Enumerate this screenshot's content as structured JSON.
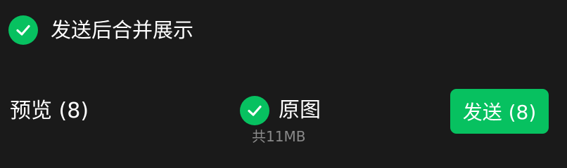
{
  "merge": {
    "checked": true,
    "icon": "check-circle-icon",
    "label": "发送后合并展示"
  },
  "bottom_bar": {
    "preview_label": "预览 (8)",
    "original": {
      "checked": true,
      "icon": "check-circle-icon",
      "label": "原图",
      "size_text": "共11MB"
    },
    "send_label": "发送 (8)"
  },
  "colors": {
    "accent": "#07c160",
    "background": "#1a1a1a",
    "text": "#ffffff",
    "muted_text": "#8a8a8a"
  }
}
